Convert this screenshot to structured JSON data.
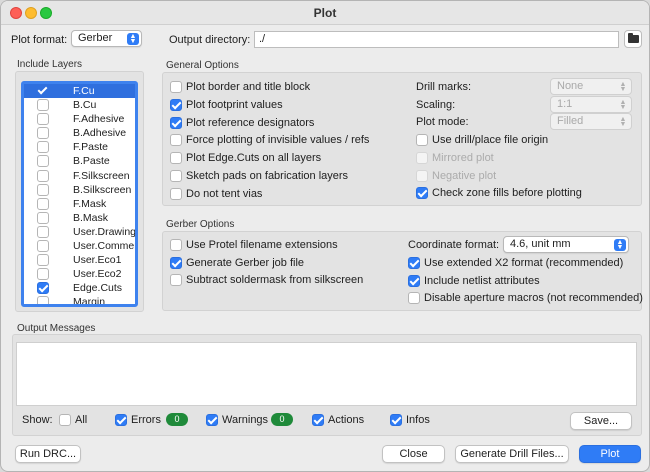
{
  "window": {
    "title": "Plot"
  },
  "header": {
    "plot_format_label": "Plot format:",
    "plot_format_value": "Gerber",
    "output_dir_label": "Output directory:",
    "output_dir_value": "./"
  },
  "include_layers": {
    "title": "Include Layers",
    "items": [
      {
        "name": "F.Cu",
        "checked": true,
        "selected": true
      },
      {
        "name": "B.Cu",
        "checked": false
      },
      {
        "name": "F.Adhesive",
        "checked": false
      },
      {
        "name": "B.Adhesive",
        "checked": false
      },
      {
        "name": "F.Paste",
        "checked": false
      },
      {
        "name": "B.Paste",
        "checked": false
      },
      {
        "name": "F.Silkscreen",
        "checked": false
      },
      {
        "name": "B.Silkscreen",
        "checked": false
      },
      {
        "name": "F.Mask",
        "checked": false
      },
      {
        "name": "B.Mask",
        "checked": false
      },
      {
        "name": "User.Drawings",
        "checked": false
      },
      {
        "name": "User.Comments",
        "checked": false
      },
      {
        "name": "User.Eco1",
        "checked": false
      },
      {
        "name": "User.Eco2",
        "checked": false
      },
      {
        "name": "Edge.Cuts",
        "checked": true
      },
      {
        "name": "Margin",
        "checked": false
      }
    ]
  },
  "general_options": {
    "title": "General Options",
    "left": [
      {
        "label": "Plot border and title block",
        "checked": false
      },
      {
        "label": "Plot footprint values",
        "checked": true
      },
      {
        "label": "Plot reference designators",
        "checked": true
      },
      {
        "label": "Force plotting of invisible values / refs",
        "checked": false
      },
      {
        "label": "Plot Edge.Cuts on all layers",
        "checked": false
      },
      {
        "label": "Sketch pads on fabrication layers",
        "checked": false
      },
      {
        "label": "Do not tent vias",
        "checked": false
      }
    ],
    "drill_marks_label": "Drill marks:",
    "drill_marks_value": "None",
    "scaling_label": "Scaling:",
    "scaling_value": "1:1",
    "plot_mode_label": "Plot mode:",
    "plot_mode_value": "Filled",
    "right": [
      {
        "label": "Use drill/place file origin",
        "checked": false,
        "disabled": false
      },
      {
        "label": "Mirrored plot",
        "checked": false,
        "disabled": true
      },
      {
        "label": "Negative plot",
        "checked": false,
        "disabled": true
      },
      {
        "label": "Check zone fills before plotting",
        "checked": true,
        "disabled": false
      }
    ]
  },
  "gerber_options": {
    "title": "Gerber Options",
    "left": [
      {
        "label": "Use Protel filename extensions",
        "checked": false
      },
      {
        "label": "Generate Gerber job file",
        "checked": true
      },
      {
        "label": "Subtract soldermask from silkscreen",
        "checked": false
      }
    ],
    "coord_format_label": "Coordinate format:",
    "coord_format_value": "4.6, unit mm",
    "right": [
      {
        "label": "Use extended X2 format (recommended)",
        "checked": true
      },
      {
        "label": "Include netlist attributes",
        "checked": true
      },
      {
        "label": "Disable aperture macros (not recommended)",
        "checked": false
      }
    ]
  },
  "output_messages": {
    "title": "Output Messages",
    "show_label": "Show:",
    "filters": [
      {
        "label": "All",
        "checked": false
      },
      {
        "label": "Errors",
        "checked": true,
        "count": "0"
      },
      {
        "label": "Warnings",
        "checked": true,
        "count": "0"
      },
      {
        "label": "Actions",
        "checked": true
      },
      {
        "label": "Infos",
        "checked": true
      }
    ],
    "save_label": "Save..."
  },
  "footer": {
    "run_drc_label": "Run DRC...",
    "close_label": "Close",
    "generate_drill_label": "Generate Drill Files...",
    "plot_label": "Plot"
  },
  "colors": {
    "accent": "#2f7cf6",
    "badge": "#1f8a3a"
  }
}
